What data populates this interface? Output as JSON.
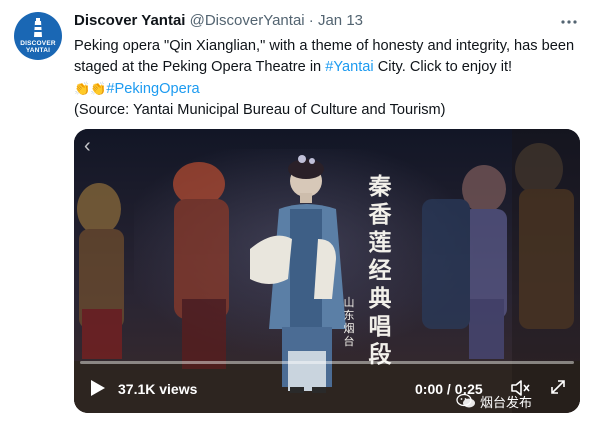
{
  "author": {
    "name": "Discover Yantai",
    "handle": "@DiscoverYantai",
    "separator": "·",
    "date": "Jan 13",
    "avatar_text_line1": "DISCOVER",
    "avatar_text_line2": "YANTAI"
  },
  "more_icon": "more-horizontal-icon",
  "tweet": {
    "text_part1": "Peking opera \"Qin Xianglian,\" with a theme of honesty and integrity, has been staged at the Peking Opera Theatre in ",
    "hashtag_yantai": "#Yantai",
    "text_part2": " City. Click to enjoy it!",
    "emoji": "👏👏",
    "hashtag_peking": "#PekingOpera",
    "source_line": "(Source: Yantai Municipal Bureau of Culture and Tourism)"
  },
  "video": {
    "overlay_title_chars": [
      "秦",
      "香",
      "莲",
      "经",
      "典",
      "唱",
      "段"
    ],
    "overlay_place_chars": [
      "山",
      "东",
      "烟",
      "台"
    ],
    "views": "37.1K views",
    "time": "0:00 / 0:25",
    "progress": 0,
    "watermark_text": "烟台发布"
  },
  "colors": {
    "link": "#1d9bf0",
    "avatar_bg": "#1a67b4",
    "text_secondary": "#536471"
  }
}
